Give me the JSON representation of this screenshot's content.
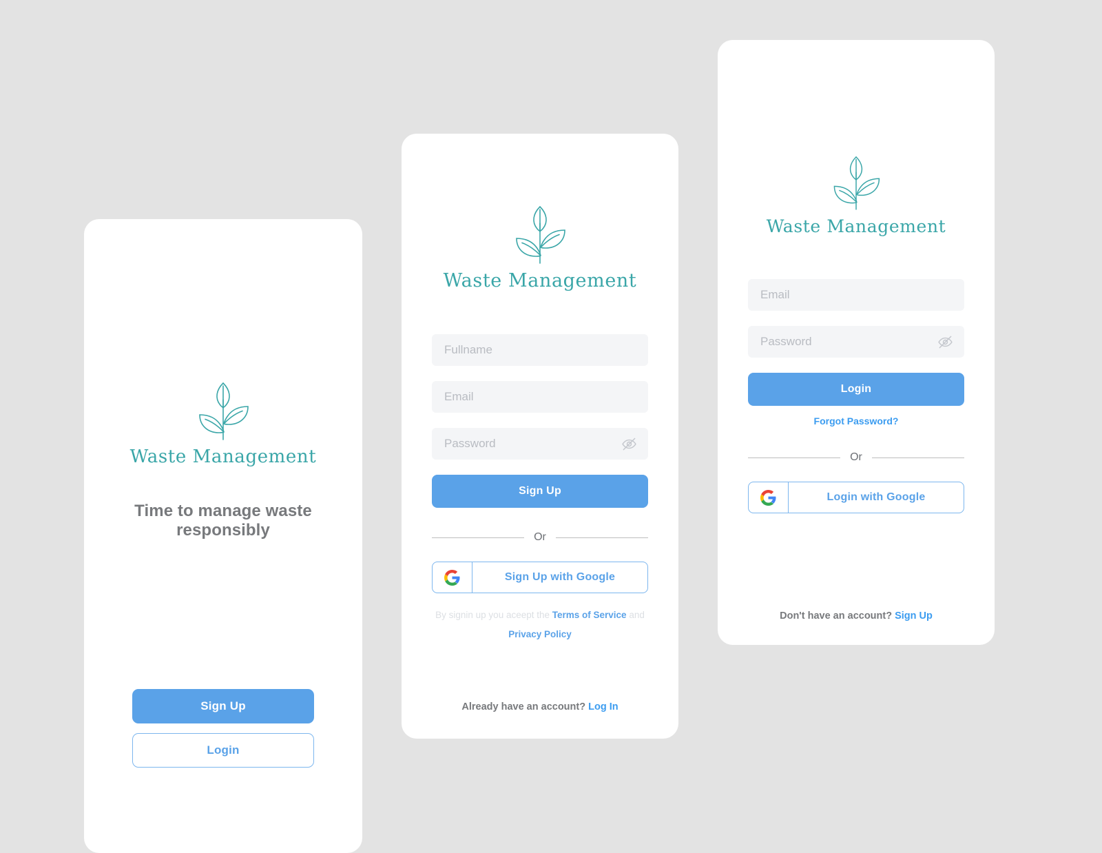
{
  "background_color": "#e3e3e3",
  "colors": {
    "brand_teal": "#3aa6a8",
    "primary_blue": "#5aa2e8",
    "link_blue": "#3b9cf0",
    "input_bg": "#f4f5f7",
    "placeholder": "#b9bcc2",
    "body_text": "#77797c"
  },
  "brand": {
    "name": "Waste Management",
    "logo_icon": "plant-sprout-leaf-icon"
  },
  "welcome_card": {
    "tagline": "Time to manage waste responsibly",
    "signup_label": "Sign Up",
    "login_label": "Login"
  },
  "signup_card": {
    "fields": [
      {
        "name": "fullname",
        "placeholder": "Fullname",
        "value": "",
        "type": "text"
      },
      {
        "name": "email",
        "placeholder": "Email",
        "value": "",
        "type": "email"
      },
      {
        "name": "password",
        "placeholder": "Password",
        "value": "",
        "type": "password"
      }
    ],
    "submit_label": "Sign Up",
    "divider_label": "Or",
    "google_label": "Sign Up with Google",
    "google_icon": "google-g-icon",
    "password_toggle_icon": "eye-off-icon",
    "terms_prefix": "By signin up you aceept the ",
    "terms_link": "Terms of Service",
    "terms_middle": " and",
    "privacy_link": "Privacy Policy",
    "bottom_note_text": "Already have an account? ",
    "bottom_note_link": "Log In"
  },
  "login_card": {
    "fields": [
      {
        "name": "email",
        "placeholder": "Email",
        "value": "",
        "type": "email"
      },
      {
        "name": "password",
        "placeholder": "Password",
        "value": "",
        "type": "password"
      }
    ],
    "submit_label": "Login",
    "forgot_label": "Forgot Password?",
    "divider_label": "Or",
    "google_label": "Login with Google",
    "google_icon": "google-g-icon",
    "password_toggle_icon": "eye-off-icon",
    "bottom_note_text": "Don't have an account? ",
    "bottom_note_link": "Sign Up"
  }
}
